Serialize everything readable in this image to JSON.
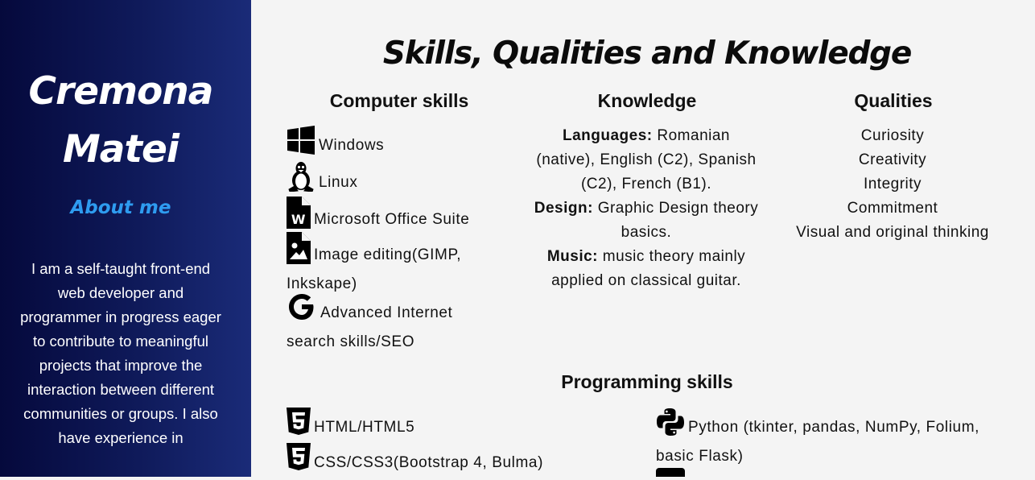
{
  "sidebar": {
    "name_line1": "Cremona",
    "name_line2": "Matei",
    "about_link": "About me",
    "about_text": "I am a self-taught front-end web developer and programmer in progress eager to contribute to meaningful projects that improve the interaction between different communities or groups. I also have experience in"
  },
  "main": {
    "title": "Skills, Qualities and Knowledge",
    "computer_skills": {
      "heading": "Computer skills",
      "items": [
        {
          "icon": "windows-icon",
          "label": "Windows"
        },
        {
          "icon": "linux-icon",
          "label": "Linux"
        },
        {
          "icon": "word-file-icon",
          "label": "Microsoft Office Suite"
        },
        {
          "icon": "image-file-icon",
          "label": "Image editing(GIMP, Inkskape)"
        },
        {
          "icon": "google-icon",
          "label": "Advanced Internet search skills/SEO"
        }
      ]
    },
    "knowledge": {
      "heading": "Knowledge",
      "languages_label": "Languages:",
      "languages_text": " Romanian (native), English (C2), Spanish (C2), French (B1).",
      "design_label": "Design:",
      "design_text": " Graphic Design theory basics.",
      "music_label": "Music:",
      "music_text": " music theory mainly applied on classical guitar."
    },
    "qualities": {
      "heading": "Qualities",
      "items": [
        "Curiosity",
        "Creativity",
        "Integrity",
        "Commitment",
        "Visual and original thinking"
      ]
    },
    "programming": {
      "heading": "Programming skills",
      "items": [
        {
          "icon": "html5-icon",
          "label": "HTML/HTML5"
        },
        {
          "icon": "css3-icon",
          "label": "CSS/CSS3(Bootstrap 4, Bulma)"
        },
        {
          "icon": "python-icon",
          "label": "Python (tkinter, pandas, NumPy, Folium, basic Flask)"
        }
      ]
    }
  }
}
